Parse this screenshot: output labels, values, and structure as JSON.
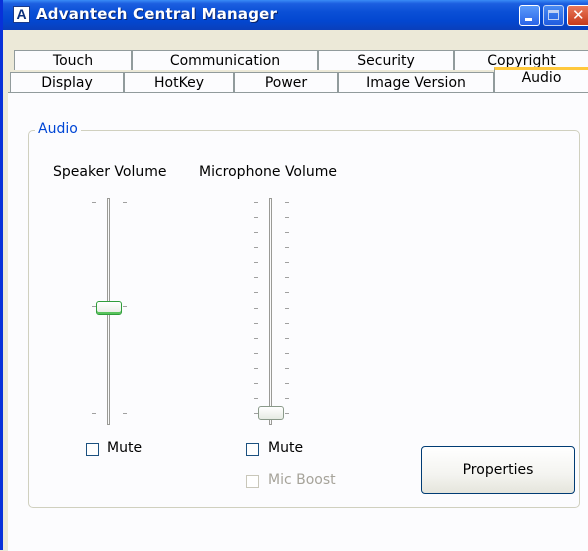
{
  "window": {
    "title": "Advantech Central Manager",
    "app_icon_glyph": "A"
  },
  "tabs_back_row": [
    "Touch",
    "Communication",
    "Security",
    "Copyright"
  ],
  "tabs_front_row": [
    "Display",
    "HotKey",
    "Power",
    "Image Version",
    "Audio"
  ],
  "active_tab": "Audio",
  "audio": {
    "group_title": "Audio",
    "speaker": {
      "label": "Speaker Volume",
      "mute_label": "Mute",
      "mute_checked": false,
      "level_fraction": 0.5
    },
    "microphone": {
      "label": "Microphone Volume",
      "mute_label": "Mute",
      "mute_checked": false,
      "level_fraction": 0.0,
      "boost_label": "Mic Boost",
      "boost_enabled": false
    },
    "properties_label": "Properties"
  },
  "colors": {
    "title_bar": "#0a4fd6",
    "group_title": "#0046d5",
    "active_tab_accent": "#ffc83c"
  }
}
